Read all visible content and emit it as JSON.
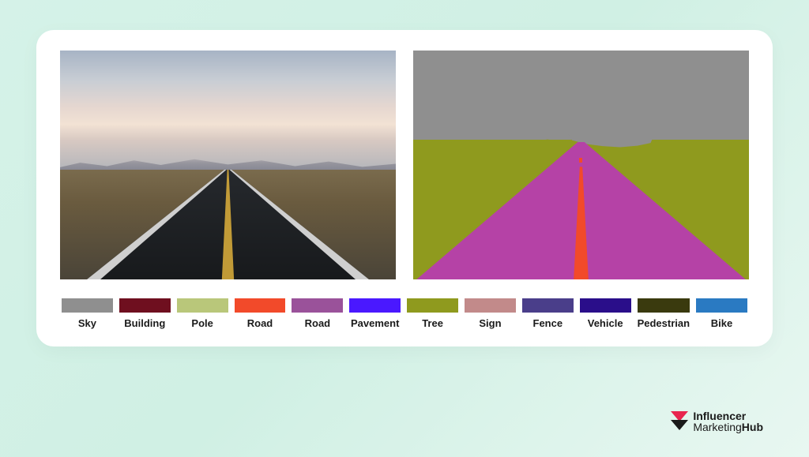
{
  "legend": [
    {
      "name": "Sky",
      "color": "#8f8f8f"
    },
    {
      "name": "Building",
      "color": "#6f0f1f"
    },
    {
      "name": "Pole",
      "color": "#b9c77a"
    },
    {
      "name": "Road",
      "color": "#f24a2a"
    },
    {
      "name": "Road",
      "color": "#9a529a"
    },
    {
      "name": "Pavement",
      "color": "#4a18ff"
    },
    {
      "name": "Tree",
      "color": "#8f9a1e"
    },
    {
      "name": "Sign",
      "color": "#c28a8a"
    },
    {
      "name": "Fence",
      "color": "#4a3e8a"
    },
    {
      "name": "Vehicle",
      "color": "#2a0e8a"
    },
    {
      "name": "Pedestrian",
      "color": "#3a3a0e"
    },
    {
      "name": "Bike",
      "color": "#2a7ac2"
    }
  ],
  "segmentation_colors": {
    "sky": "#8f8f8f",
    "tree": "#8f9a1e",
    "road_marker": "#f24a2a",
    "road_surface": "#b542a6"
  },
  "brand": {
    "line1": "Influencer",
    "line2_light": "Marketing",
    "line2_bold": "Hub"
  }
}
